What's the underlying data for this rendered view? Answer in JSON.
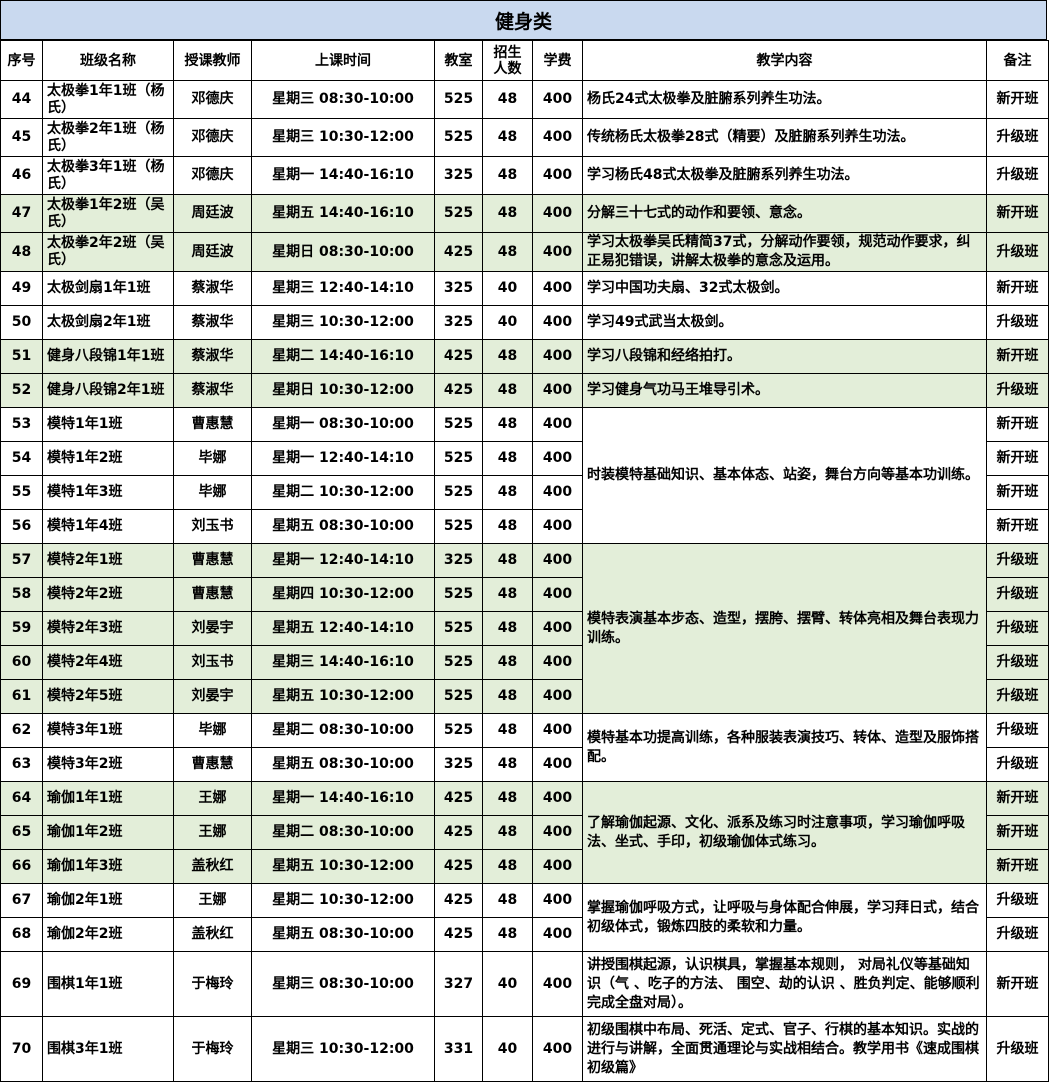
{
  "title": "健身类",
  "headers": [
    "序号",
    "班级名称",
    "授课教师",
    "上课时间",
    "教室",
    "招生人数",
    "学费",
    "教学内容",
    "备注"
  ],
  "rows": [
    {
      "no": "44",
      "cls": "太极拳1年1班（杨氏）",
      "teacher": "邓德庆",
      "time": "星期三 08:30-10:00",
      "room": "525",
      "num": "48",
      "fee": "400",
      "content": "杨氏24式太极拳及脏腑系列养生功法。",
      "note": "新开班"
    },
    {
      "no": "45",
      "cls": "太极拳2年1班（杨氏）",
      "teacher": "邓德庆",
      "time": "星期三 10:30-12:00",
      "room": "525",
      "num": "48",
      "fee": "400",
      "content": "传统杨氏太极拳28式（精要）及脏腑系列养生功法。",
      "note": "升级班"
    },
    {
      "no": "46",
      "cls": "太极拳3年1班（杨氏）",
      "teacher": "邓德庆",
      "time": "星期一 14:40-16:10",
      "room": "325",
      "num": "48",
      "fee": "400",
      "content": "学习杨氏48式太极拳及脏腑系列养生功法。",
      "note": "升级班"
    },
    {
      "no": "47",
      "cls": "太极拳1年2班（吴氏）",
      "teacher": "周廷波",
      "time": "星期五 14:40-16:10",
      "room": "525",
      "num": "48",
      "fee": "400",
      "content": "分解三十七式的动作和要领、意念。",
      "note": "新开班"
    },
    {
      "no": "48",
      "cls": "太极拳2年2班（吴氏）",
      "teacher": "周廷波",
      "time": "星期日 08:30-10:00",
      "room": "425",
      "num": "48",
      "fee": "400",
      "content": "学习太极拳吴氏精简37式，分解动作要领，规范动作要求，纠正易犯错误，讲解太极拳的意念及运用。",
      "note": "升级班"
    },
    {
      "no": "49",
      "cls": "太极剑扇1年1班",
      "teacher": "蔡淑华",
      "time": "星期三 12:40-14:10",
      "room": "325",
      "num": "40",
      "fee": "400",
      "content": "学习中国功夫扇、32式太极剑。",
      "note": "新开班"
    },
    {
      "no": "50",
      "cls": "太极剑扇2年1班",
      "teacher": "蔡淑华",
      "time": "星期三 10:30-12:00",
      "room": "325",
      "num": "40",
      "fee": "400",
      "content": "学习49式武当太极剑。",
      "note": "升级班"
    },
    {
      "no": "51",
      "cls": "健身八段锦1年1班",
      "teacher": "蔡淑华",
      "time": "星期二 14:40-16:10",
      "room": "425",
      "num": "48",
      "fee": "400",
      "content": "学习八段锦和经络拍打。",
      "note": "新开班"
    },
    {
      "no": "52",
      "cls": "健身八段锦2年1班",
      "teacher": "蔡淑华",
      "time": "星期日 10:30-12:00",
      "room": "425",
      "num": "48",
      "fee": "400",
      "content": "学习健身气功马王堆导引术。",
      "note": "升级班"
    },
    {
      "no": "53",
      "cls": "模特1年1班",
      "teacher": "曹惠慧",
      "time": "星期一 08:30-10:00",
      "room": "525",
      "num": "48",
      "fee": "400",
      "note": "新开班"
    },
    {
      "no": "54",
      "cls": "模特1年2班",
      "teacher": "毕娜",
      "time": "星期一 12:40-14:10",
      "room": "525",
      "num": "48",
      "fee": "400",
      "note": "新开班"
    },
    {
      "no": "55",
      "cls": "模特1年3班",
      "teacher": "毕娜",
      "time": "星期二 10:30-12:00",
      "room": "525",
      "num": "48",
      "fee": "400",
      "note": "新开班"
    },
    {
      "no": "56",
      "cls": "模特1年4班",
      "teacher": "刘玉书",
      "time": "星期五 08:30-10:00",
      "room": "525",
      "num": "48",
      "fee": "400",
      "note": "新开班"
    },
    {
      "no": "57",
      "cls": "模特2年1班",
      "teacher": "曹惠慧",
      "time": "星期一 12:40-14:10",
      "room": "325",
      "num": "48",
      "fee": "400",
      "note": "升级班"
    },
    {
      "no": "58",
      "cls": "模特2年2班",
      "teacher": "曹惠慧",
      "time": "星期四 10:30-12:00",
      "room": "525",
      "num": "48",
      "fee": "400",
      "note": "升级班"
    },
    {
      "no": "59",
      "cls": "模特2年3班",
      "teacher": "刘晏宇",
      "time": "星期五 12:40-14:10",
      "room": "525",
      "num": "48",
      "fee": "400",
      "note": "升级班"
    },
    {
      "no": "60",
      "cls": "模特2年4班",
      "teacher": "刘玉书",
      "time": "星期三 14:40-16:10",
      "room": "525",
      "num": "48",
      "fee": "400",
      "note": "升级班"
    },
    {
      "no": "61",
      "cls": "模特2年5班",
      "teacher": "刘晏宇",
      "time": "星期五 10:30-12:00",
      "room": "525",
      "num": "48",
      "fee": "400",
      "note": "升级班"
    },
    {
      "no": "62",
      "cls": "模特3年1班",
      "teacher": "毕娜",
      "time": "星期二 08:30-10:00",
      "room": "525",
      "num": "48",
      "fee": "400",
      "note": "升级班"
    },
    {
      "no": "63",
      "cls": "模特3年2班",
      "teacher": "曹惠慧",
      "time": "星期五 08:30-10:00",
      "room": "325",
      "num": "48",
      "fee": "400",
      "note": "升级班"
    },
    {
      "no": "64",
      "cls": "瑜伽1年1班",
      "teacher": "王娜",
      "time": "星期一 14:40-16:10",
      "room": "425",
      "num": "48",
      "fee": "400",
      "note": "新开班"
    },
    {
      "no": "65",
      "cls": "瑜伽1年2班",
      "teacher": "王娜",
      "time": "星期二 08:30-10:00",
      "room": "425",
      "num": "48",
      "fee": "400",
      "note": "新开班"
    },
    {
      "no": "66",
      "cls": "瑜伽1年3班",
      "teacher": "盖秋红",
      "time": "星期五 10:30-12:00",
      "room": "425",
      "num": "48",
      "fee": "400",
      "note": "新开班"
    },
    {
      "no": "67",
      "cls": "瑜伽2年1班",
      "teacher": "王娜",
      "time": "星期二 10:30-12:00",
      "room": "425",
      "num": "48",
      "fee": "400",
      "note": "升级班"
    },
    {
      "no": "68",
      "cls": "瑜伽2年2班",
      "teacher": "盖秋红",
      "time": "星期五 08:30-10:00",
      "room": "425",
      "num": "48",
      "fee": "400",
      "note": "升级班"
    },
    {
      "no": "69",
      "cls": "围棋1年1班",
      "teacher": "于梅玲",
      "time": "星期三 08:30-10:00",
      "room": "327",
      "num": "40",
      "fee": "400",
      "content": "讲授围棋起源，认识棋具，掌握基本规则， 对局礼仪等基础知识（气 、吃子的方法、 围空、劫的认识 、胜负判定、能够顺利完成全盘对局）。",
      "note": "新开班"
    },
    {
      "no": "70",
      "cls": "围棋3年1班",
      "teacher": "于梅玲",
      "time": "星期三 10:30-12:00",
      "room": "331",
      "num": "40",
      "fee": "400",
      "content": "初级围棋中布局、死活、定式、官子、行棋的基本知识。实战的进行与讲解，全面贯通理论与实战相结合。教学用书《速成围棋初级篇》",
      "note": "升级班"
    }
  ],
  "merged_content": {
    "model_1": "时装模特基础知识、基本体态、站姿，舞台方向等基本功训练。",
    "model_2": "模特表演基本步态、造型，摆胯、摆臂、转体亮相及舞台表现力训练。",
    "model_3": "模特基本功提高训练，各种服装表演技巧、转体、造型及服饰搭配。",
    "yoga_1": "了解瑜伽起源、文化、派系及练习时注意事项，学习瑜伽呼吸法、坐式、手印，初级瑜伽体式练习。",
    "yoga_2": "掌握瑜伽呼吸方式，让呼吸与身体配合伸展，学习拜日式，结合初级体式，锻炼四肢的柔软和力量。"
  },
  "colors": {
    "title_bg": "#c9d9ef",
    "shade": "#e3eed9"
  }
}
